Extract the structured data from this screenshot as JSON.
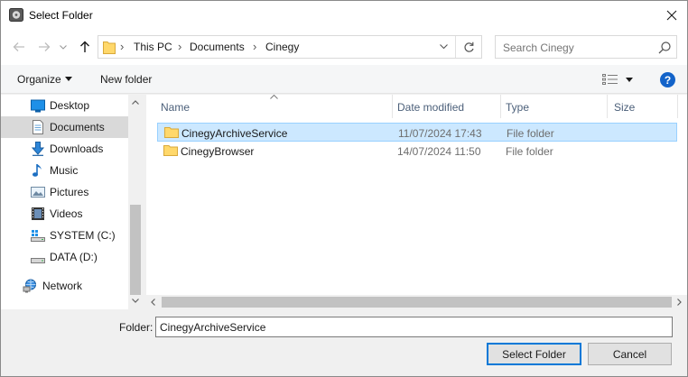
{
  "window": {
    "title": "Select Folder",
    "icon": "disk-folder-icon",
    "close_icon": "close-icon"
  },
  "nav": {
    "back_icon": "back-arrow-icon",
    "forward_icon": "forward-arrow-icon",
    "recent_icon": "chevron-down-icon",
    "up_icon": "up-arrow-icon",
    "breadcrumbs": [
      "This PC",
      "Documents",
      "Cinegy"
    ],
    "refresh_icon": "refresh-icon",
    "search_placeholder": "Search Cinegy"
  },
  "toolbar": {
    "organize_label": "Organize",
    "new_folder_label": "New folder",
    "view_icon": "details-view-icon",
    "help_label": "?"
  },
  "sidebar": {
    "items": [
      {
        "label": "Desktop",
        "icon": "desktop-icon"
      },
      {
        "label": "Documents",
        "icon": "documents-icon",
        "selected": true
      },
      {
        "label": "Downloads",
        "icon": "downloads-icon"
      },
      {
        "label": "Music",
        "icon": "music-icon"
      },
      {
        "label": "Pictures",
        "icon": "pictures-icon"
      },
      {
        "label": "Videos",
        "icon": "videos-icon"
      },
      {
        "label": "SYSTEM (C:)",
        "icon": "system-drive-icon"
      },
      {
        "label": "DATA (D:)",
        "icon": "drive-icon"
      },
      {
        "label": "Network",
        "icon": "network-icon"
      }
    ]
  },
  "filelist": {
    "columns": [
      "Name",
      "Date modified",
      "Type",
      "Size"
    ],
    "rows": [
      {
        "name": "CinegyArchiveService",
        "date": "11/07/2024 17:43",
        "type": "File folder",
        "selected": true
      },
      {
        "name": "CinegyBrowser",
        "date": "14/07/2024 11:50",
        "type": "File folder",
        "selected": false
      }
    ]
  },
  "footer": {
    "folder_label": "Folder:",
    "folder_value": "CinegyArchiveService",
    "select_label": "Select Folder",
    "cancel_label": "Cancel"
  },
  "colors": {
    "selection": "#cce8ff",
    "accent": "#0078d7",
    "folder": "#ffd86b"
  }
}
